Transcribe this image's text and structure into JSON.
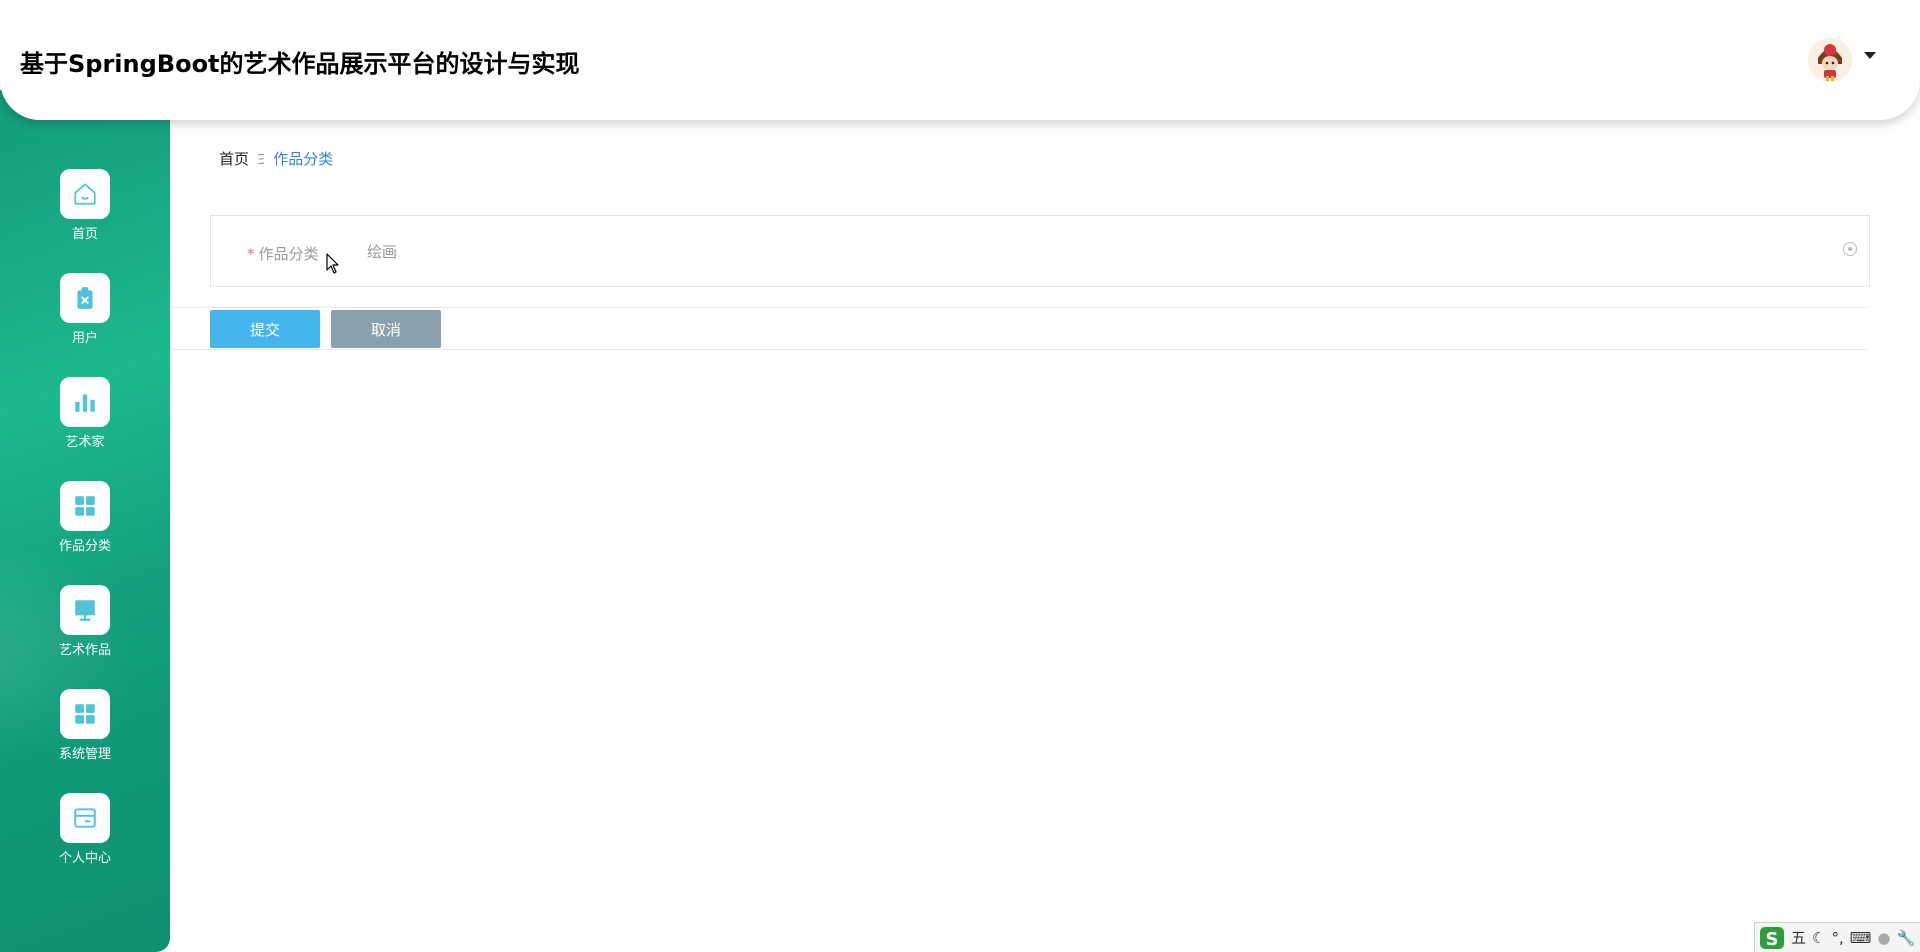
{
  "header": {
    "title": "基于SpringBoot的艺术作品展示平台的设计与实现",
    "avatar_icon": "user-avatar-icon",
    "dropdown_icon": "caret-down-icon"
  },
  "sidebar": {
    "items": [
      {
        "label": "首页",
        "icon": "home-icon"
      },
      {
        "label": "用户",
        "icon": "clipboard-icon"
      },
      {
        "label": "艺术家",
        "icon": "bar-chart-icon"
      },
      {
        "label": "作品分类",
        "icon": "grid-icon"
      },
      {
        "label": "艺术作品",
        "icon": "monitor-icon"
      },
      {
        "label": "系统管理",
        "icon": "grid-icon"
      },
      {
        "label": "个人中心",
        "icon": "card-icon"
      }
    ],
    "colors": {
      "bg": "#17a884",
      "icon": "#4fc3d9"
    }
  },
  "breadcrumb": {
    "home": "首页",
    "separator": "Ξ",
    "current": "作品分类"
  },
  "form": {
    "field_label": "作品分类",
    "required_mark": "*",
    "field_value": "绘画",
    "submit_label": "提交",
    "cancel_label": "取消"
  },
  "ime": {
    "logo": "S",
    "mode": "五",
    "icons": [
      "moon-icon",
      "punctuation-icon",
      "keyboard-icon",
      "user-icon",
      "wrench-icon"
    ]
  }
}
